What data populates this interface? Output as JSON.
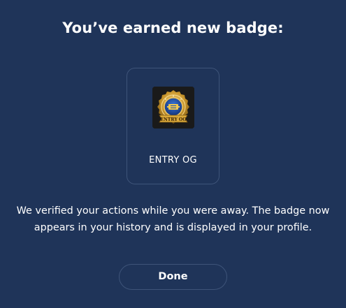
{
  "modal": {
    "title": "You’ve earned new badge:",
    "badge": {
      "name": "ENTRY OG",
      "icon": "entry-og-badge-icon",
      "ribbon_text": "ENTRY OG"
    },
    "description": "We verified your actions while you were away. The badge now appears in your history and is displayed in your profile.",
    "done_label": "Done"
  },
  "colors": {
    "background": "#1f3459",
    "border": "#3e5479",
    "text": "#ffffff",
    "badge_gold": "#c9962c",
    "badge_blue": "#1d4fa8"
  }
}
